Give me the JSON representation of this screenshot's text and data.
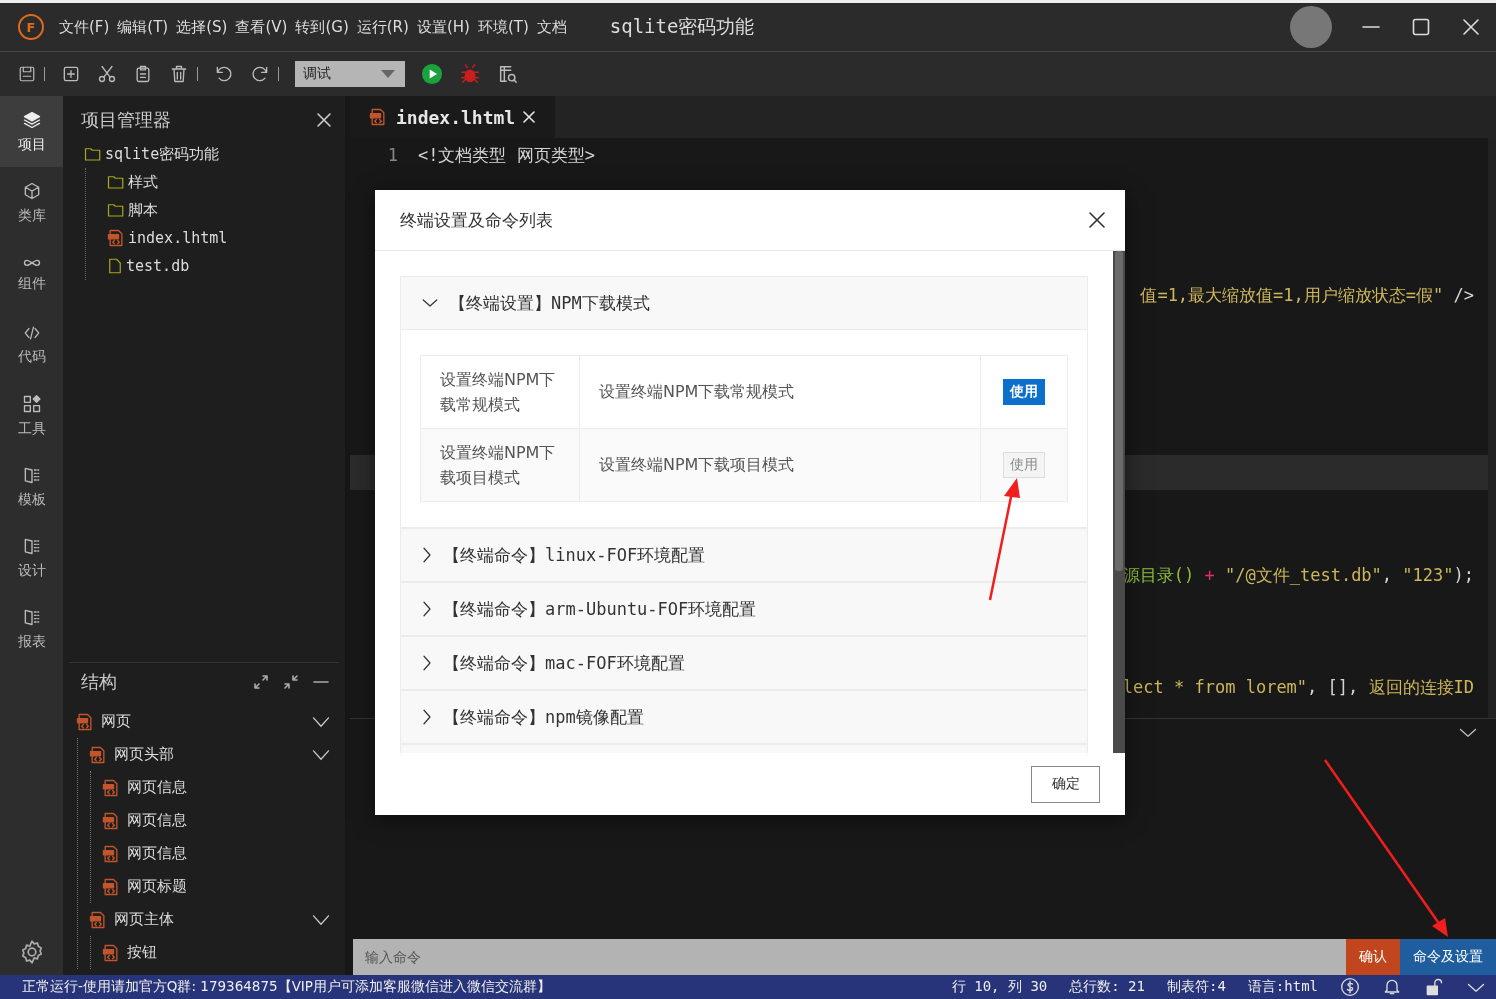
{
  "window": {
    "logo": "F",
    "menu": [
      "文件(F)",
      "编辑(T)",
      "选择(S)",
      "查看(V)",
      "转到(G)",
      "运行(R)",
      "设置(H)",
      "环境(T)",
      "文档"
    ],
    "title": "sqlite密码功能"
  },
  "toolbar": {
    "run_mode": "调试"
  },
  "activity_bar": [
    {
      "label": "项目",
      "kind": "layers",
      "selected": true
    },
    {
      "label": "类库",
      "kind": "cube",
      "selected": false
    },
    {
      "label": "组件",
      "kind": "link",
      "selected": false
    },
    {
      "label": "代码",
      "kind": "code",
      "selected": false
    },
    {
      "label": "工具",
      "kind": "widgets",
      "selected": false
    },
    {
      "label": "模板",
      "kind": "book",
      "selected": false
    },
    {
      "label": "设计",
      "kind": "book",
      "selected": false
    },
    {
      "label": "报表",
      "kind": "book",
      "selected": false
    }
  ],
  "project_panel": {
    "title": "项目管理器",
    "tree": [
      {
        "label": "sqlite密码功能",
        "kind": "folder",
        "children": [
          {
            "label": "样式",
            "kind": "folder"
          },
          {
            "label": "脚本",
            "kind": "folder"
          },
          {
            "label": "index.lhtml",
            "kind": "page"
          },
          {
            "label": "test.db",
            "kind": "file"
          }
        ]
      }
    ]
  },
  "structure_panel": {
    "title": "结构",
    "tree": [
      {
        "label": "网页",
        "expanded": true,
        "children": [
          {
            "label": "网页头部",
            "expanded": true,
            "children": [
              {
                "label": "网页信息"
              },
              {
                "label": "网页信息"
              },
              {
                "label": "网页信息"
              },
              {
                "label": "网页标题"
              }
            ]
          },
          {
            "label": "网页主体",
            "expanded": true,
            "children": [
              {
                "label": "按钮"
              }
            ]
          }
        ]
      }
    ]
  },
  "editor": {
    "tabs": [
      {
        "label": "index.lhtml",
        "selected": true
      }
    ],
    "lines": [
      {
        "number": "1",
        "segments": [
          {
            "kind": "plain",
            "text": "<!文档类型 网页类型>"
          }
        ]
      },
      {
        "segments": [
          {
            "kind": "string",
            "text": "值=1,最大缩放值=1,用户缩放状态=假\""
          },
          {
            "kind": "plain",
            "text": " />"
          }
        ]
      },
      {
        "segments": [
          {
            "kind": "func",
            "text": "源目录()"
          },
          {
            "kind": "op",
            "text": " + "
          },
          {
            "kind": "string",
            "text": "\"/@文件_test.db\""
          },
          {
            "kind": "plain",
            "text": ", "
          },
          {
            "kind": "string",
            "text": "\"123\""
          },
          {
            "kind": "plain",
            "text": ");"
          }
        ]
      },
      {
        "segments": [
          {
            "kind": "string",
            "text": "lect * from lorem\""
          },
          {
            "kind": "plain",
            "text": ", [], "
          },
          {
            "kind": "string",
            "text": "返回的连接ID"
          }
        ]
      }
    ]
  },
  "terminal": {
    "placeholder": "输入命令",
    "buttons": [
      {
        "label": "确认",
        "kind": "confirm"
      },
      {
        "label": "命令及设置",
        "kind": "settings"
      }
    ]
  },
  "status_bar": {
    "message": "正常运行-使用请加官方Q群: 179364875【VIP用户可添加客服微信进入微信交流群】",
    "items": [
      "行 10, 列 30",
      "总行数: 21",
      "制表符:4",
      "语言:html"
    ]
  },
  "dialog": {
    "title": "终端设置及命令列表",
    "sections": [
      {
        "label": "【终端设置】NPM下载模式",
        "expanded": true,
        "rows": [
          {
            "name": "设置终端NPM下载常规模式",
            "description": "设置终端NPM下载常规模式",
            "action": "使用",
            "disabled": false
          },
          {
            "name": "设置终端NPM下载项目模式",
            "description": "设置终端NPM下载项目模式",
            "action": "使用",
            "disabled": true
          }
        ]
      },
      {
        "label": "【终端命令】linux-FOF环境配置",
        "expanded": false
      },
      {
        "label": "【终端命令】arm-Ubuntu-FOF环境配置",
        "expanded": false
      },
      {
        "label": "【终端命令】mac-FOF环境配置",
        "expanded": false
      },
      {
        "label": "【终端命令】npm镜像配置",
        "expanded": false
      }
    ],
    "ok_button": "确定"
  }
}
